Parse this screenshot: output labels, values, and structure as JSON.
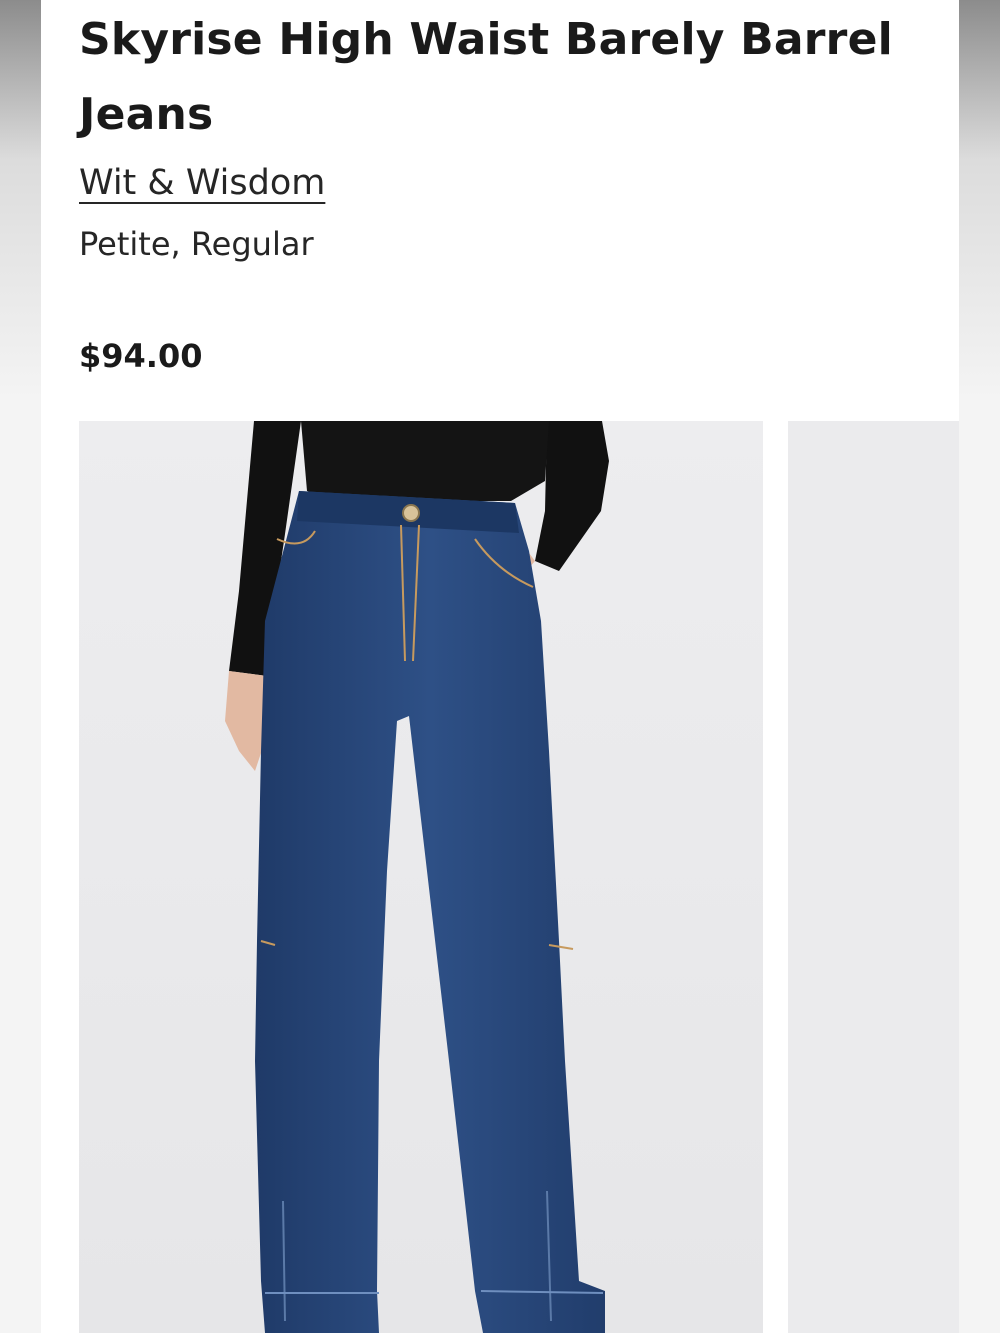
{
  "product": {
    "title": "Skyrise High Waist Barely Barrel Jeans",
    "brand": "Wit & Wisdom",
    "fits": "Petite, Regular",
    "price": "$94.00"
  },
  "gallery": {
    "images": [
      {
        "alt": "Model wearing dark wash barrel jeans with black long sleeve top"
      },
      {
        "alt": "Next product image"
      }
    ]
  },
  "colors": {
    "text": "#1a1a1a",
    "denim": "#2b4a7c",
    "background": "#ffffff"
  }
}
